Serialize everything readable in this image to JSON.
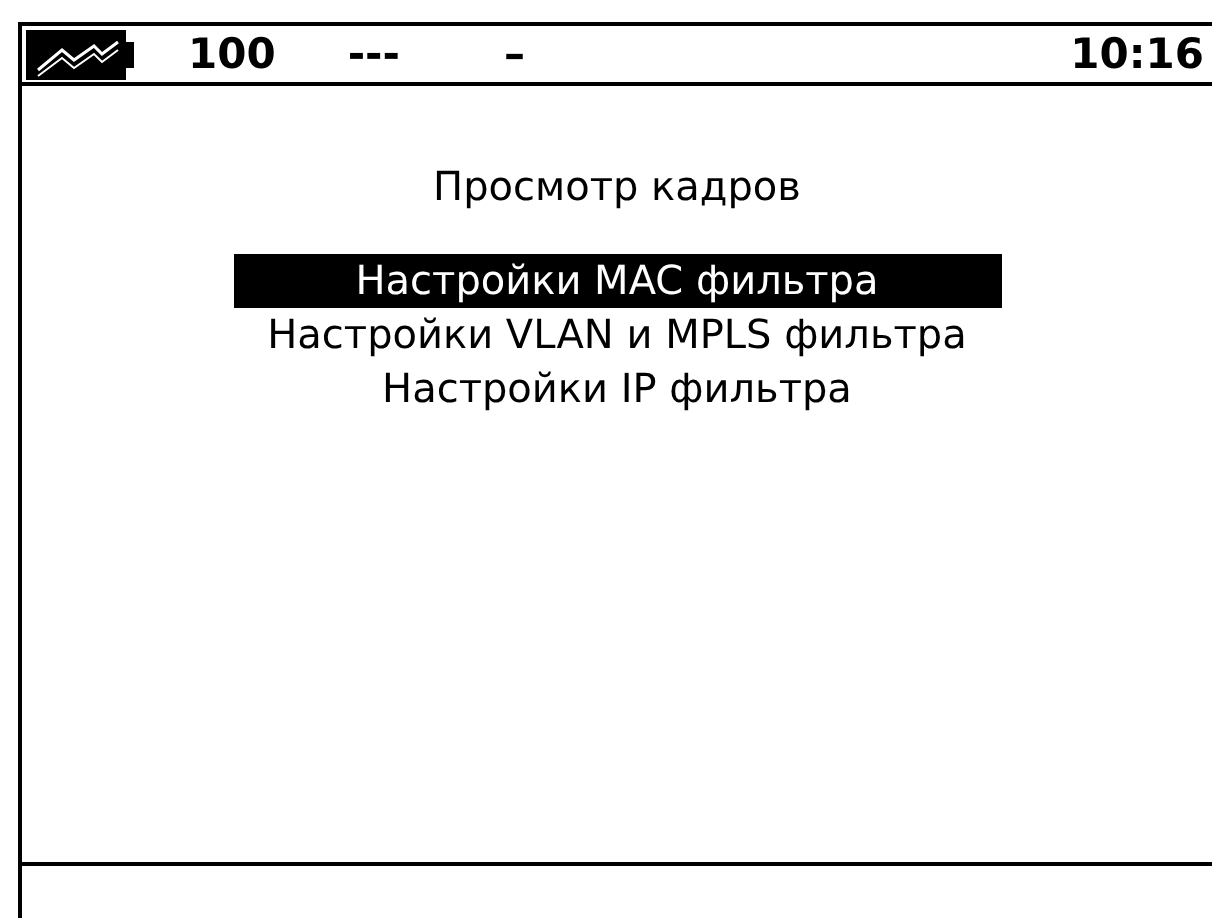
{
  "status_bar": {
    "value": "100",
    "field_2": "---",
    "field_3": "–",
    "time": "10:16"
  },
  "title": "Просмотр кадров",
  "menu": [
    {
      "label": "Настройки MAC фильтра",
      "selected": true
    },
    {
      "label": "Настройки VLAN и MPLS фильтра",
      "selected": false
    },
    {
      "label": "Настройки IP фильтра",
      "selected": false
    }
  ]
}
